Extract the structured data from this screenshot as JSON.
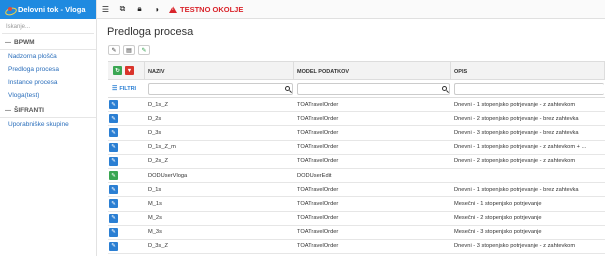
{
  "app": {
    "title": "Delovni tok - Vloga"
  },
  "sidebar": {
    "search_placeholder": "Iskanje...",
    "sections": [
      {
        "label": "BPWM",
        "items": [
          "Nadzorna plošča",
          "Predloga procesa",
          "Instance procesa",
          "Vloga(test)"
        ]
      },
      {
        "label": "ŠIFRANTI",
        "items": [
          "Uporabniške skupine"
        ]
      }
    ]
  },
  "topbar": {
    "icons": [
      "menu-icon",
      "external-link-icon",
      "lock-icon",
      "contrast-icon"
    ],
    "env_label": "TESTNO OKOLJE",
    "env_color": "#d9242b"
  },
  "page": {
    "title": "Predloga procesa"
  },
  "grid": {
    "columns": [
      "NAZIV",
      "MODEL PODATKOV",
      "OPIS"
    ],
    "filter_label": "FILTRI",
    "rows": [
      {
        "naziv": "D_1s_Z",
        "model": "TOATravelOrder",
        "opis": "Dnevni - 1 stopenjsko potrjevanje - z zahtevkom",
        "action": "edit"
      },
      {
        "naziv": "D_2s",
        "model": "TOATravelOrder",
        "opis": "Dnevni - 2 stopenjsko potrjevanje - brez zahtevka",
        "action": "edit"
      },
      {
        "naziv": "D_3s",
        "model": "TOATravelOrder",
        "opis": "Dnevni - 3 stopenjsko potrjevanje - brez zahtevka",
        "action": "edit"
      },
      {
        "naziv": "D_1s_Z_m",
        "model": "TOATravelOrder",
        "opis": "Dnevni - 1 stopenjsko potrjevanje - z zahtevkom + ...",
        "action": "edit"
      },
      {
        "naziv": "D_2s_Z",
        "model": "TOATravelOrder",
        "opis": "Dnevni - 2 stopenjsko potrjevanje - z zahtevkom",
        "action": "edit"
      },
      {
        "naziv": "DODUserVloga",
        "model": "DODUserEdit",
        "opis": "",
        "action": "edit-green"
      },
      {
        "naziv": "D_1s",
        "model": "TOATravelOrder",
        "opis": "Dnevni - 1 stopenjsko potrjevanje - brez zahtevka",
        "action": "edit"
      },
      {
        "naziv": "M_1s",
        "model": "TOATravelOrder",
        "opis": "Mesečni - 1 stopenjsko potrjevanje",
        "action": "edit"
      },
      {
        "naziv": "M_2s",
        "model": "TOATravelOrder",
        "opis": "Mesečni - 2 stopenjsko potrjevanje",
        "action": "edit"
      },
      {
        "naziv": "M_3s",
        "model": "TOATravelOrder",
        "opis": "Mesečni - 3 stopenjsko potrjevanje",
        "action": "edit"
      },
      {
        "naziv": "D_3s_Z",
        "model": "TOATravelOrder",
        "opis": "Dnevni - 3 stopenjsko potrjevanje - z zahtevkom",
        "action": "edit"
      }
    ]
  },
  "colors": {
    "accent": "#1f8ae0",
    "edit_blue": "#2b7fd3",
    "edit_green": "#3aa652",
    "filter_red": "#d9342b"
  }
}
